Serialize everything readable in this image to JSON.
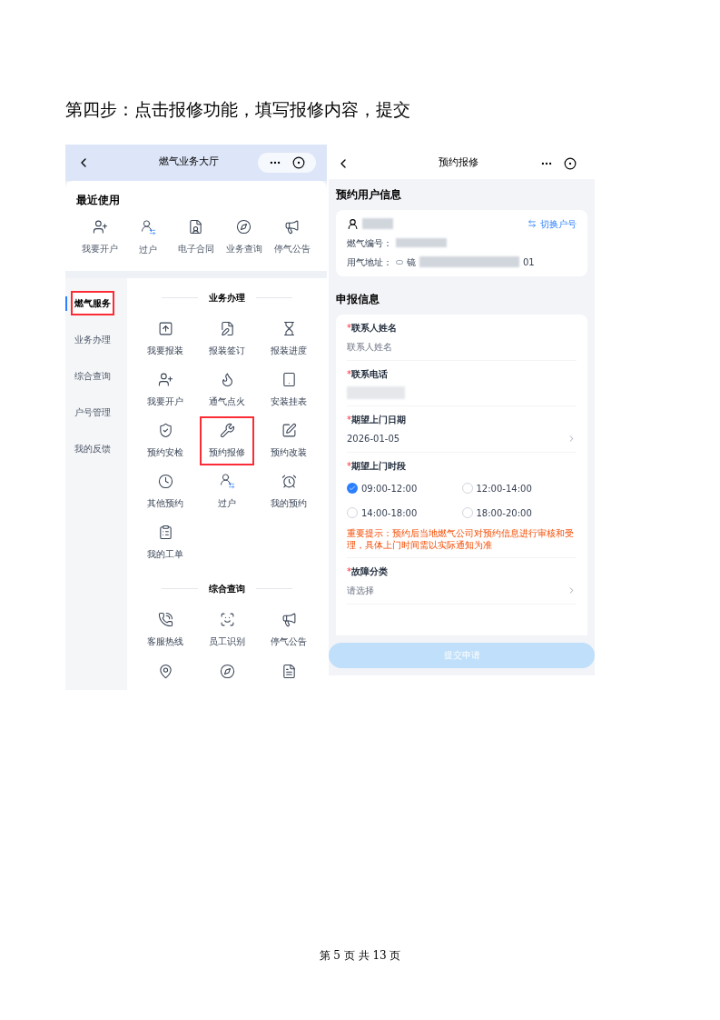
{
  "heading": "第四步：点击报修功能，填写报修内容，提交",
  "left_screen": {
    "title": "燃气业务大厅",
    "recent": {
      "title": "最近使用",
      "items": [
        {
          "label": "我要开户"
        },
        {
          "label": "过户"
        },
        {
          "label": "电子合同"
        },
        {
          "label": "业务查询"
        },
        {
          "label": "停气公告"
        }
      ]
    },
    "sidebar": [
      {
        "label": "燃气服务",
        "selected": true,
        "highlighted": true
      },
      {
        "label": "业务办理",
        "selected": false,
        "highlighted": false
      },
      {
        "label": "综合查询",
        "selected": false,
        "highlighted": false
      },
      {
        "label": "户号管理",
        "selected": false,
        "highlighted": false
      },
      {
        "label": "我的反馈",
        "selected": false,
        "highlighted": false
      }
    ],
    "sections": [
      {
        "title": "业务办理",
        "items": [
          {
            "label": "我要报装",
            "highlighted": false
          },
          {
            "label": "报装签订",
            "highlighted": false
          },
          {
            "label": "报装进度",
            "highlighted": false
          },
          {
            "label": "我要开户",
            "highlighted": false
          },
          {
            "label": "通气点火",
            "highlighted": false
          },
          {
            "label": "安装挂表",
            "highlighted": false
          },
          {
            "label": "预约安检",
            "highlighted": false
          },
          {
            "label": "预约报修",
            "highlighted": true
          },
          {
            "label": "预约改装",
            "highlighted": false
          },
          {
            "label": "其他预约",
            "highlighted": false
          },
          {
            "label": "过户",
            "highlighted": false
          },
          {
            "label": "我的预约",
            "highlighted": false
          },
          {
            "label": "我的工单",
            "highlighted": false
          }
        ]
      },
      {
        "title": "综合查询",
        "items": [
          {
            "label": "客服热线",
            "highlighted": false
          },
          {
            "label": "员工识别",
            "highlighted": false
          },
          {
            "label": "停气公告",
            "highlighted": false
          }
        ]
      }
    ]
  },
  "right_screen": {
    "title": "预约报修",
    "user_section": "预约用户信息",
    "switch_link": "切换户号",
    "gas_no_label": "燃气编号：",
    "address_label": "用气地址：",
    "address_start": "镜",
    "address_end": "01",
    "form_section": "申报信息",
    "required_mark": "*",
    "fields": [
      {
        "kind": "text",
        "label": "联系人姓名",
        "placeholder": "联系人姓名"
      },
      {
        "kind": "redacted",
        "label": "联系电话"
      },
      {
        "kind": "select",
        "label": "期望上门日期",
        "value": "2026-01-05"
      },
      {
        "kind": "radios",
        "label": "期望上门时段",
        "options": [
          {
            "label": "09:00-12:00",
            "selected": true
          },
          {
            "label": "12:00-14:00",
            "selected": false
          },
          {
            "label": "14:00-18:00",
            "selected": false
          },
          {
            "label": "18:00-20:00",
            "selected": false
          }
        ],
        "note": "重要提示：预约后当地燃气公司对预约信息进行审核和受理，具体上门时间需以实际通知为准"
      },
      {
        "kind": "select",
        "label": "故障分类",
        "placeholder": "请选择"
      }
    ],
    "submit": "提交申请"
  },
  "footer": "第 5 页 共 13 页"
}
